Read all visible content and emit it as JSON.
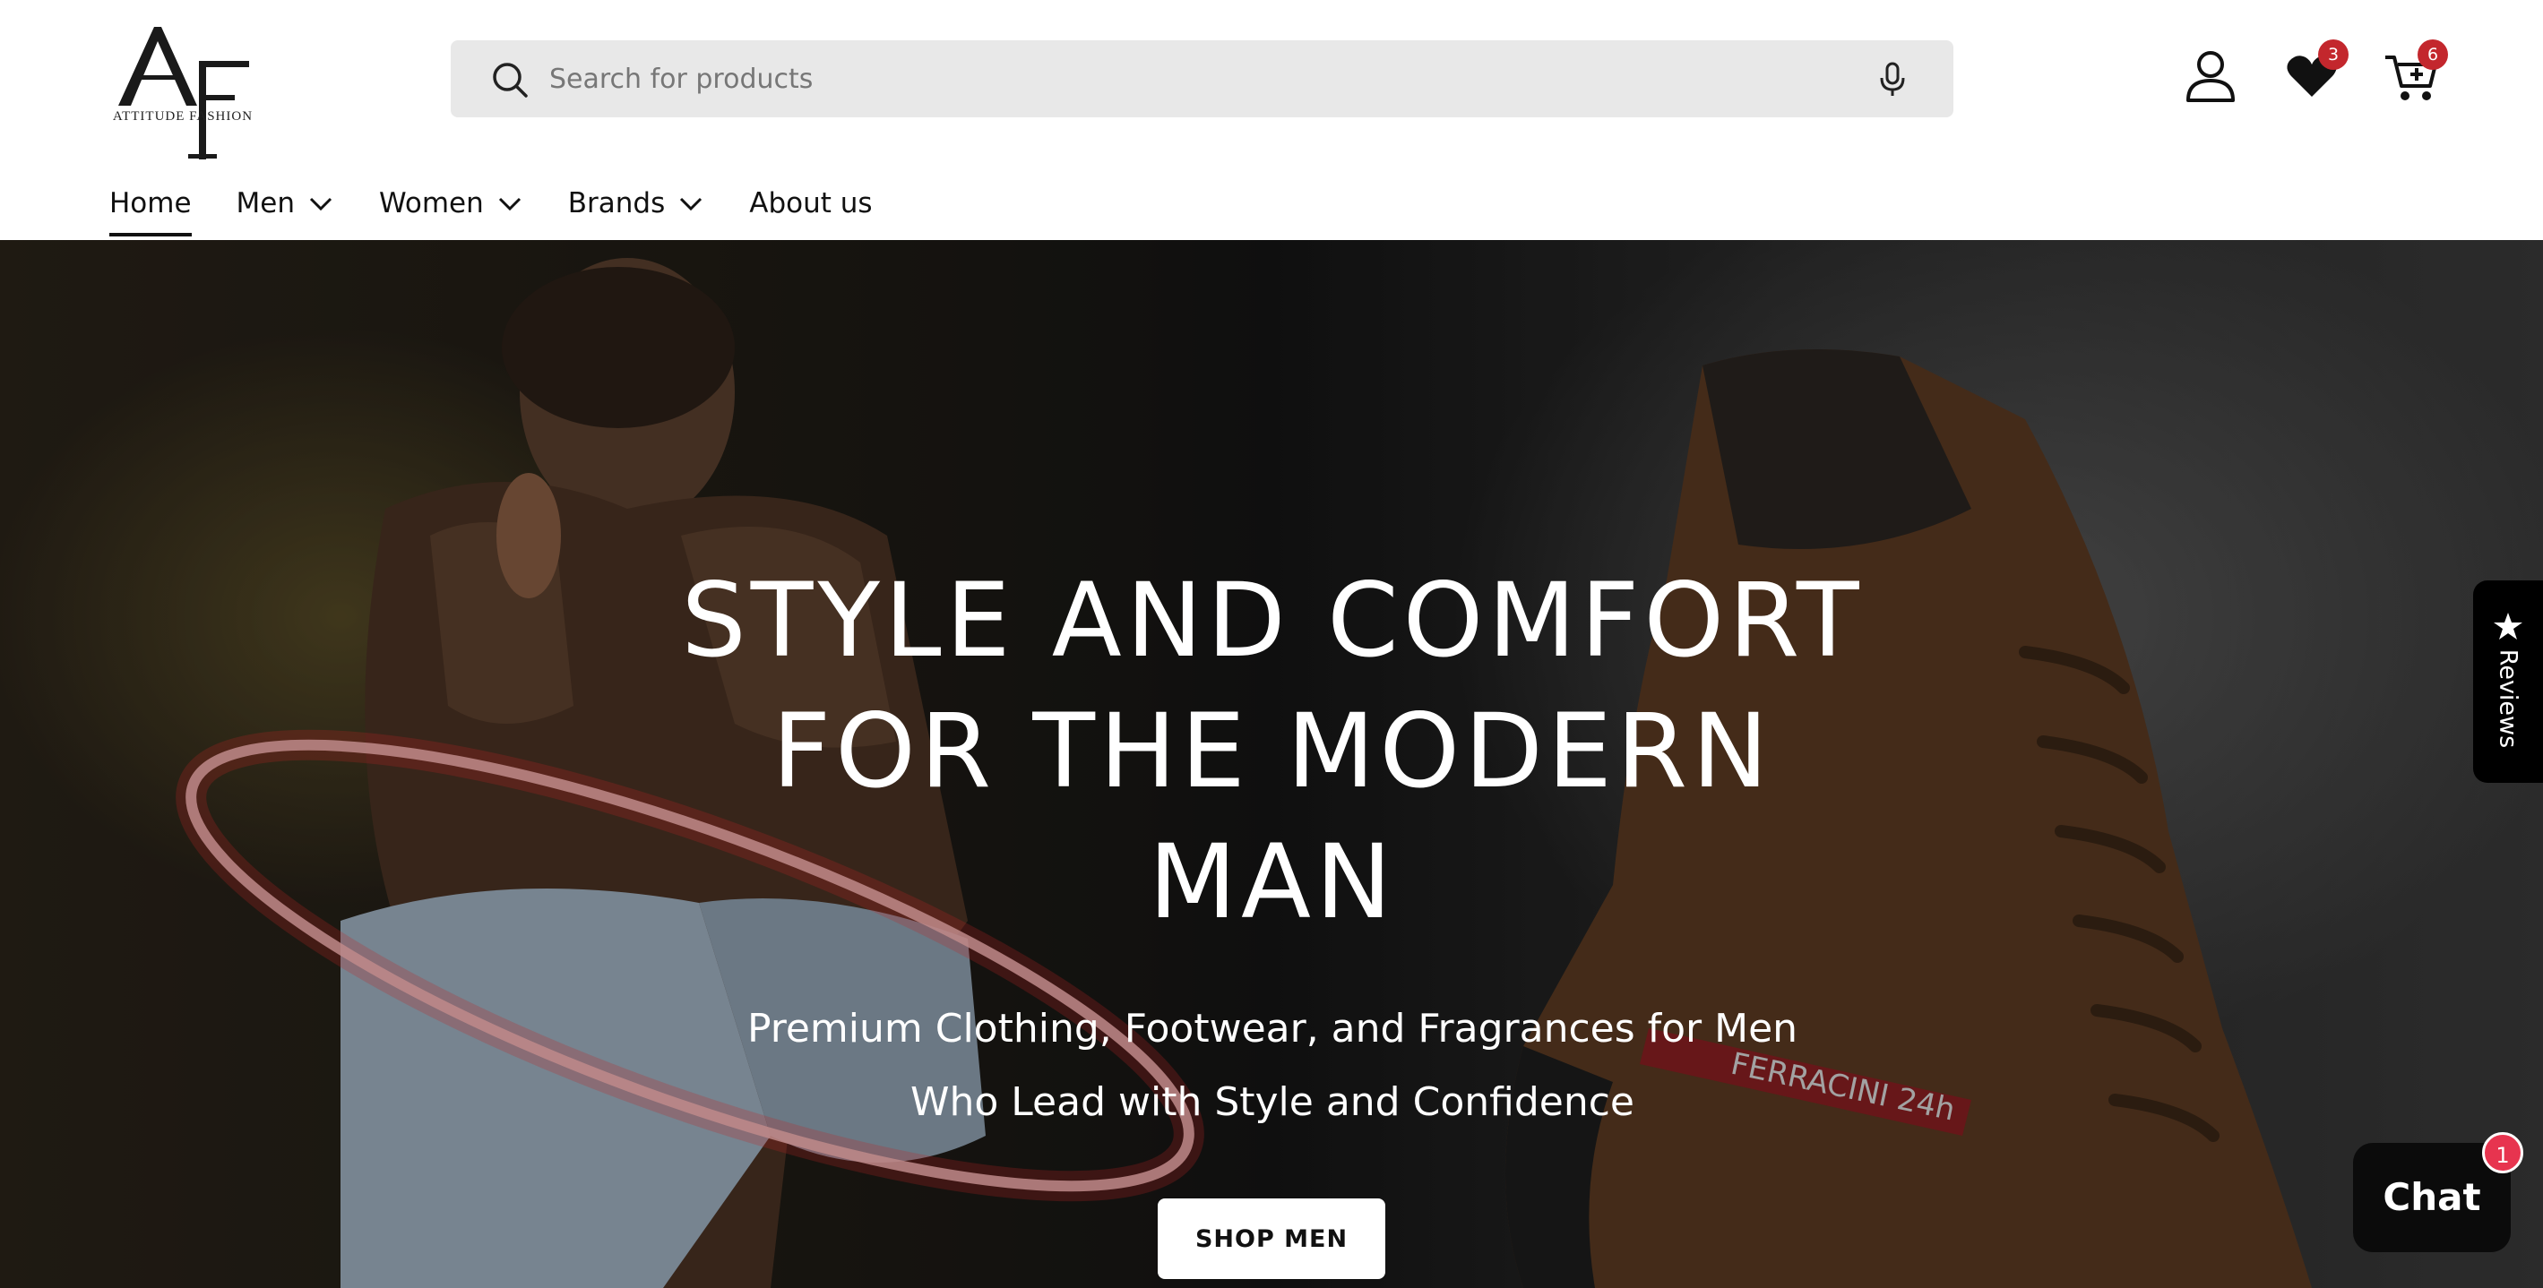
{
  "brand": {
    "logo_monogram": "AF",
    "logo_text": "ATTITUDE FASHION"
  },
  "search": {
    "placeholder": "Search for products",
    "value": ""
  },
  "header_icons": {
    "account": "account-icon",
    "wishlist": "heart-icon",
    "cart": "cart-icon",
    "wishlist_count": "3",
    "cart_count": "6"
  },
  "nav": {
    "items": [
      {
        "label": "Home",
        "active": true,
        "dropdown": false
      },
      {
        "label": "Men",
        "active": false,
        "dropdown": true
      },
      {
        "label": "Women",
        "active": false,
        "dropdown": true
      },
      {
        "label": "Brands",
        "active": false,
        "dropdown": true
      },
      {
        "label": "About us",
        "active": false,
        "dropdown": false
      }
    ]
  },
  "hero": {
    "title": "STYLE AND COMFORT FOR THE MODERN MAN",
    "subtitle": "Premium Clothing, Footwear, and Fragrances for Men Who Lead with Style and Confidence",
    "cta_label": "SHOP MEN",
    "boot_brand_text": "FERRACINI 24h"
  },
  "reviews_tab": {
    "label": "Reviews",
    "icon": "star-icon"
  },
  "chat": {
    "label": "Chat",
    "badge": "1"
  },
  "colors": {
    "badge_red": "#c3272d",
    "chat_badge": "#e7344f",
    "search_bg": "#e8e8e8",
    "button_bg": "#ffffff"
  }
}
